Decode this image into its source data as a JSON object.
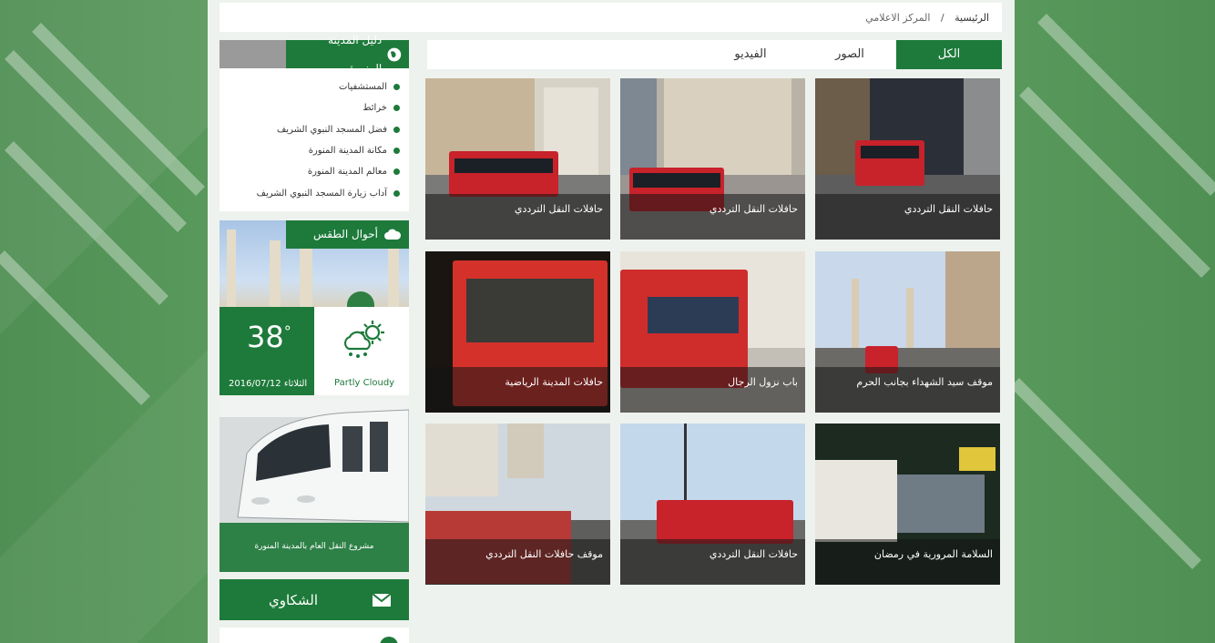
{
  "breadcrumb": {
    "home": "الرئيسية",
    "separator": "/",
    "current": "المركز الاعلامي"
  },
  "tabs": [
    {
      "label": "الكل",
      "active": true
    },
    {
      "label": "الصور",
      "active": false
    },
    {
      "label": "الفيديو",
      "active": false
    }
  ],
  "gallery": [
    {
      "caption": "حافلات النقل الترددي"
    },
    {
      "caption": "حافلات النقل الترددي"
    },
    {
      "caption": "حافلات النقل الترددي"
    },
    {
      "caption": "موقف سيد الشهداء بجانب الحرم"
    },
    {
      "caption": "باب نزول الرجال"
    },
    {
      "caption": "حافلات المدينة الرياضية"
    },
    {
      "caption": "السلامة المرورية في رمضان"
    },
    {
      "caption": "حافلات النقل الترددي"
    },
    {
      "caption": "موقف حافلات النقل الترددي"
    }
  ],
  "guide": {
    "title": "دليل المدينة المنورة",
    "icon": "globe-icon",
    "items": [
      "المستشفيات",
      "خرائط",
      "فضل المسجد النبوي الشريف",
      "مكانة المدينة المنورة",
      "معالم المدينة المنورة",
      "آداب زيارة المسجد النبوي الشريف"
    ]
  },
  "weather": {
    "title": "أحوال الطقس",
    "icon": "cloud-icon",
    "temperature": "38",
    "degree": "°",
    "condition": "Partly Cloudy",
    "date": "الثلاثاء 2016/07/12"
  },
  "train": {
    "caption": "مشروع النقل العام بالمدينة المنورة"
  },
  "complaints": {
    "label": "الشكاوي",
    "icon": "envelope-icon"
  },
  "colors": {
    "brand_green": "#1d7a3a",
    "page_bg": "#eef2ee"
  }
}
